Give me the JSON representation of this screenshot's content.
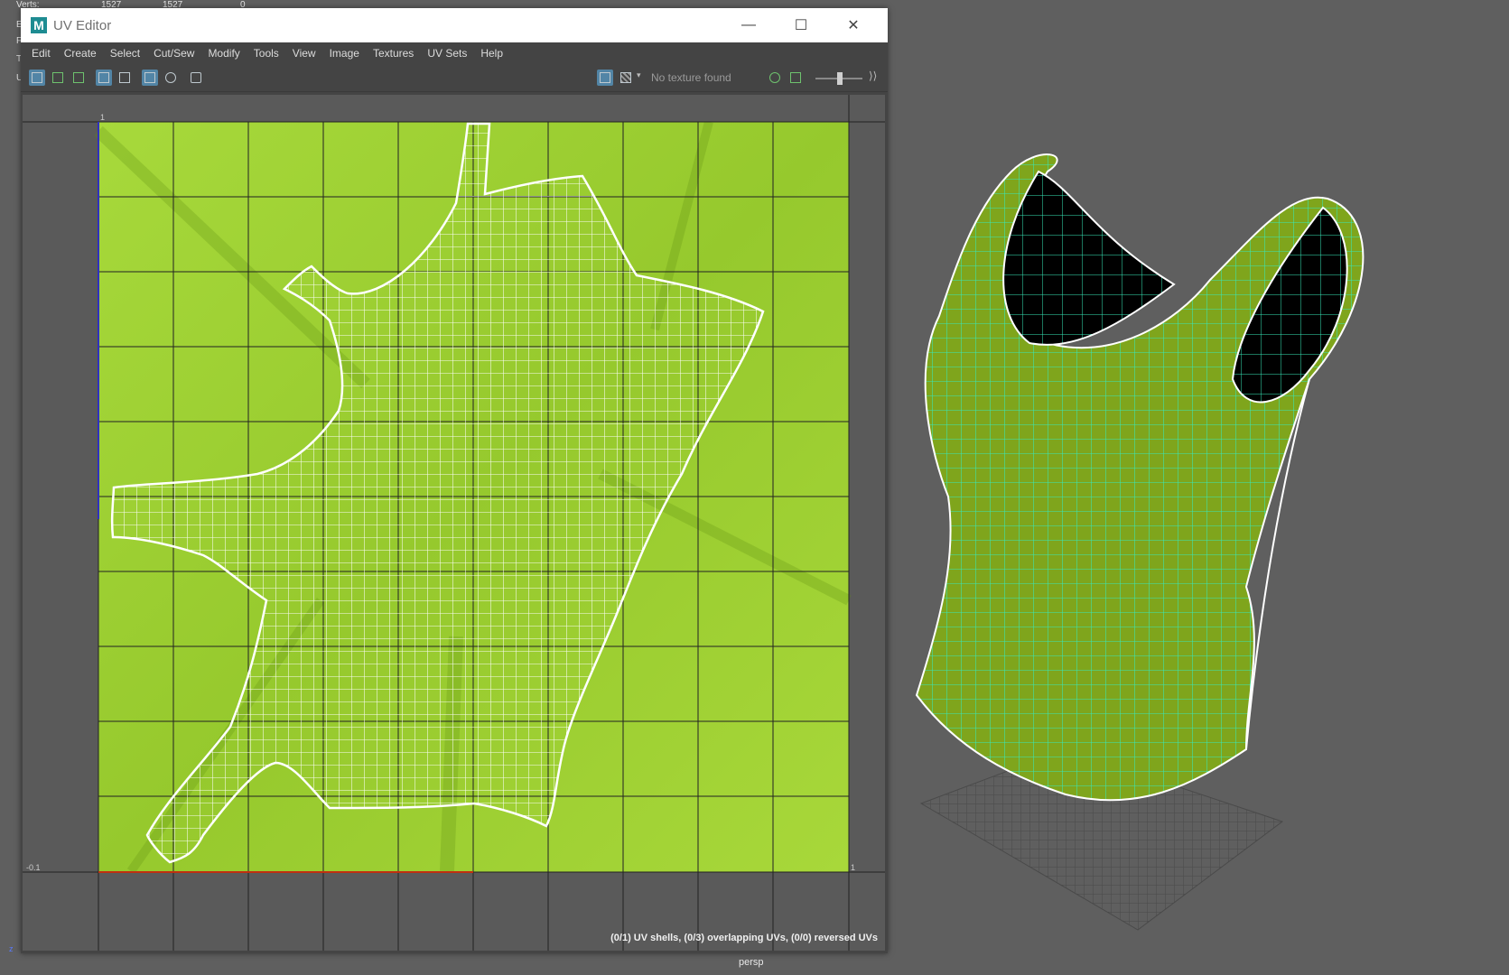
{
  "hud": {
    "rows": [
      {
        "label": "Verts:",
        "v1": "1527",
        "v2": "1527",
        "v3": "0"
      },
      {
        "label": "E",
        "v1": "",
        "v2": "",
        "v3": ""
      },
      {
        "label": "F",
        "v1": "",
        "v2": "",
        "v3": ""
      },
      {
        "label": "T",
        "v1": "",
        "v2": "",
        "v3": ""
      },
      {
        "label": "U",
        "v1": "",
        "v2": "",
        "v3": ""
      }
    ]
  },
  "viewport": {
    "camera_label": "persp",
    "axis_label": "z"
  },
  "uv_editor": {
    "title": "UV Editor",
    "window_buttons": {
      "minimize": "—",
      "maximize": "☐",
      "close": "✕"
    },
    "menu": [
      "Edit",
      "Create",
      "Select",
      "Cut/Sew",
      "Modify",
      "Tools",
      "View",
      "Image",
      "Textures",
      "UV Sets",
      "Help"
    ],
    "toolbar": {
      "texture_status": "No texture found",
      "buttons": [
        "uv-shell-select-icon",
        "uv-component-icon",
        "uv-image-icon",
        "wireframe-icon",
        "checker-icon",
        "grid-icon",
        "isolate-icon",
        "snapshot-icon",
        "display-image-icon",
        "checker-map-icon",
        "dim-image-icon"
      ]
    },
    "canvas": {
      "tick_top": "1",
      "tick_left_bottom": "-0.1",
      "tick_right_bottom": "1",
      "status": "(0/1) UV shells, (0/3) overlapping UVs, (0/0) reversed UVs"
    }
  },
  "colors": {
    "canvas_green": "#a3d636",
    "uv_line": "#ffffff",
    "mesh_wire": "#38e8b8",
    "background": "#5f5f5f"
  }
}
